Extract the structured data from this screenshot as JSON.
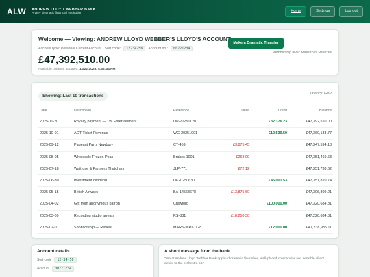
{
  "header": {
    "logo": "ALW",
    "bank_name": "ANDREW LLOYD WEBBER BANK",
    "tagline": "A very dramatic financial institution",
    "nav": [
      {
        "label": "Home"
      },
      {
        "label": "Settings"
      },
      {
        "label": "Log out"
      }
    ]
  },
  "account": {
    "welcome": "Welcome — Viewing: ANDREW LLOYD WEBBER'S LLOYD'S ACCOUNT",
    "type_text": "Account type: Personal Current Account · Sort code:",
    "sort_code": "12-34-56",
    "account_no_label": "Account no.:",
    "account_no": "00771234",
    "balance": "£47,392,510.00",
    "updated_label": "Available balance updated:",
    "updated_value": "11/22/2025, 4:32:34 PM",
    "transfer_button": "Make a Dramatic Transfer",
    "membership": "Membership level: Maestro of Musicals"
  },
  "transactions": {
    "showing": "Showing: Last 10 transactions",
    "currency": "Currency: GBP",
    "columns": [
      "Date",
      "Description",
      "Reference",
      "Debit",
      "Credit",
      "Balance"
    ],
    "rows": [
      {
        "date": "2025-11-20",
        "description": "Royalty payment — LW Entertainment",
        "reference": "LW-20251120",
        "debit": "",
        "credit": "£32,376.23",
        "balance": "£47,392,510.00"
      },
      {
        "date": "2025-10-01",
        "description": "AGT Ticket Revenue",
        "reference": "WG-20251001",
        "debit": "",
        "credit": "£12,539.59",
        "balance": "£47,360,133.77"
      },
      {
        "date": "2025-09-12",
        "description": "Pageant Party Newbury",
        "reference": "CT-459",
        "debit": "£3,875.45",
        "credit": "",
        "balance": "£47,347,594.18"
      },
      {
        "date": "2025-08-05",
        "description": "Wholesale Frozen Peas",
        "reference": "Brakes-1001",
        "debit": "£268.99",
        "credit": "",
        "balance": "£47,351,469.63"
      },
      {
        "date": "2025-07-18",
        "description": "Waitrose & Partners Thatcham",
        "reference": "JLP-771",
        "debit": "£72.12",
        "credit": "",
        "balance": "£47,351,738.62"
      },
      {
        "date": "2025-06-30",
        "description": "Investment dividend",
        "reference": "IN-20250630",
        "debit": "",
        "credit": "£45,001.53",
        "balance": "£47,351,810.74"
      },
      {
        "date": "2025-05-15",
        "description": "British Airways",
        "reference": "BA-14563678",
        "debit": "£13,875.60",
        "credit": "",
        "balance": "£47,306,809.21"
      },
      {
        "date": "2025-04-02",
        "description": "Gift from anonymous patron",
        "reference": "Crawford",
        "debit": "",
        "credit": "£100,000.00",
        "balance": "£47,320,684.81"
      },
      {
        "date": "2025-03-09",
        "description": "Recording studio arrears",
        "reference": "RS-331",
        "debit": "£18,250.30",
        "credit": "",
        "balance": "£47,220,684.81"
      },
      {
        "date": "2025-02-01",
        "description": "Sponsorship — Revels",
        "reference": "MARS-WRI-1128",
        "debit": "",
        "credit": "£12,000.00",
        "balance": "£47,238,935.11"
      }
    ]
  },
  "details": {
    "title": "Account details",
    "sort_code_label": "Sort code",
    "sort_code": "12-34-56",
    "account_label": "Account",
    "account": "00771234"
  },
  "message": {
    "title": "A short message from the bank",
    "text": "\"We at Andrew Lloyd Webber Bank applaud dramatic flourishes, well-placed crescendos and sensible direct debits to the orchestra pit.\""
  },
  "colors": {
    "header_dark": "#063b2c",
    "accent": "#0b7a4f",
    "debit": "#c62828",
    "credit": "#0a7a3e"
  }
}
